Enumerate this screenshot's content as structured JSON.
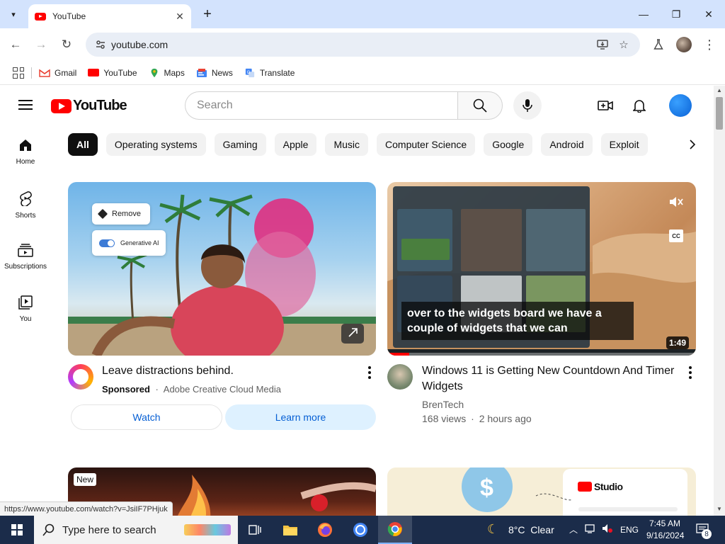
{
  "browser": {
    "tab_title": "YouTube",
    "url": "youtube.com",
    "bookmarks": [
      {
        "label": "Gmail",
        "icon": "gmail-icon",
        "color": "#ea4335"
      },
      {
        "label": "YouTube",
        "icon": "youtube-icon",
        "color": "#ff0000"
      },
      {
        "label": "Maps",
        "icon": "maps-icon",
        "color": "#34a853"
      },
      {
        "label": "News",
        "icon": "news-icon",
        "color": "#4285f4"
      },
      {
        "label": "Translate",
        "icon": "translate-icon",
        "color": "#4285f4"
      }
    ],
    "status_url": "https://www.youtube.com/watch?v=JsiIF7PHjuk"
  },
  "youtube": {
    "logo_text": "YouTube",
    "search_placeholder": "Search",
    "sidebar": [
      {
        "label": "Home",
        "icon": "home-icon"
      },
      {
        "label": "Shorts",
        "icon": "shorts-icon"
      },
      {
        "label": "Subscriptions",
        "icon": "subscriptions-icon"
      },
      {
        "label": "You",
        "icon": "you-icon"
      }
    ],
    "chips": [
      "All",
      "Operating systems",
      "Gaming",
      "Apple",
      "Music",
      "Computer Science",
      "Google",
      "Android",
      "Exploit"
    ],
    "ad_card": {
      "overlay_remove": "Remove",
      "overlay_generative": "Generative AI",
      "title": "Leave distractions behind.",
      "sponsored": "Sponsored",
      "advertiser": "Adobe Creative Cloud Media",
      "watch_label": "Watch",
      "learn_more_label": "Learn more"
    },
    "video_card": {
      "caption_line1": "over to the widgets board we have a",
      "caption_line2": "couple of widgets that we can",
      "duration": "1:49",
      "cc_label": "CC",
      "title": "Windows 11 is Getting New Countdown And Timer Widgets",
      "channel": "BrenTech",
      "views": "168 views",
      "age": "2 hours ago",
      "progress": 0.07
    },
    "row2_badge": "New",
    "studio_text": "Studio"
  },
  "taskbar": {
    "search_placeholder": "Type here to search",
    "weather": "8°C  Clear",
    "language": "ENG",
    "time": "7:45 AM",
    "date": "9/16/2024",
    "notification_count": "8"
  },
  "colors": {
    "brand_red": "#ff0000",
    "chrome_tabstrip": "#d3e3fd",
    "taskbar": "#1b2c4a",
    "link_blue": "#065fd4"
  }
}
